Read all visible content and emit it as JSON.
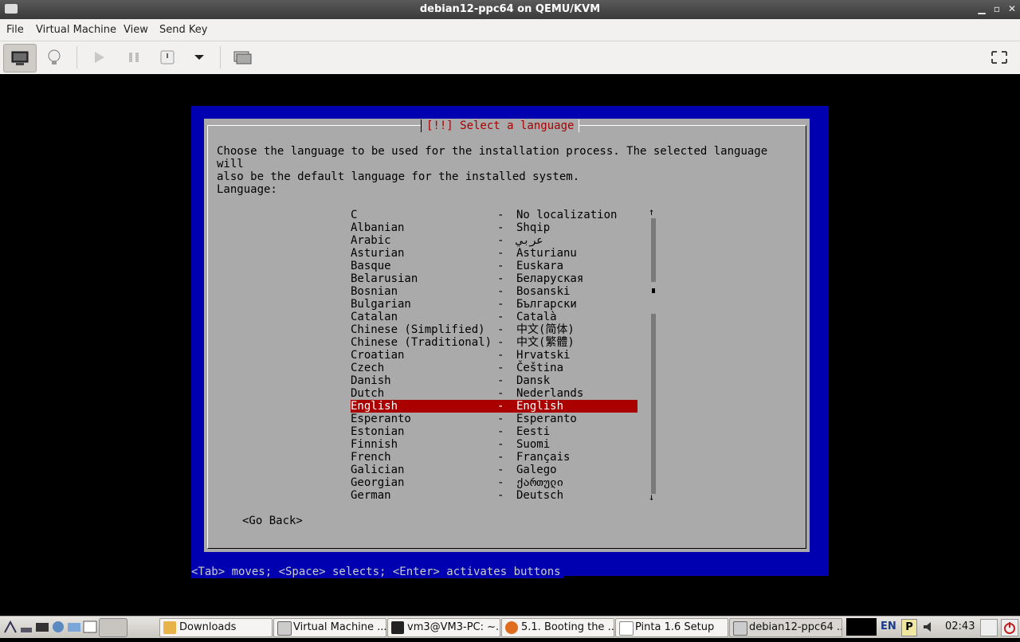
{
  "window": {
    "title": "debian12-ppc64 on QEMU/KVM"
  },
  "menu": [
    "File",
    "Virtual Machine",
    "View",
    "Send Key"
  ],
  "colors": {
    "installer_bg": "#0000b0",
    "dialog_bg": "#aaaaaa",
    "title_red": "#a80000",
    "selected_row": "#aa0000"
  },
  "installer": {
    "dialog_title": "[!!] Select a language",
    "description": "Choose the language to be used for the installation process. The selected language will\nalso be the default language for the installed system.",
    "label": "Language:",
    "languages": [
      {
        "name": "C",
        "native": "No localization"
      },
      {
        "name": "Albanian",
        "native": "Shqip"
      },
      {
        "name": "Arabic",
        "native": "عربي"
      },
      {
        "name": "Asturian",
        "native": "Asturianu"
      },
      {
        "name": "Basque",
        "native": "Euskara"
      },
      {
        "name": "Belarusian",
        "native": "Беларуская"
      },
      {
        "name": "Bosnian",
        "native": "Bosanski"
      },
      {
        "name": "Bulgarian",
        "native": "Български"
      },
      {
        "name": "Catalan",
        "native": "Català"
      },
      {
        "name": "Chinese (Simplified)",
        "native": "中文(简体)"
      },
      {
        "name": "Chinese (Traditional)",
        "native": "中文(繁體)"
      },
      {
        "name": "Croatian",
        "native": "Hrvatski"
      },
      {
        "name": "Czech",
        "native": "Čeština"
      },
      {
        "name": "Danish",
        "native": "Dansk"
      },
      {
        "name": "Dutch",
        "native": "Nederlands"
      },
      {
        "name": "English",
        "native": "English",
        "selected": true
      },
      {
        "name": "Esperanto",
        "native": "Esperanto"
      },
      {
        "name": "Estonian",
        "native": "Eesti"
      },
      {
        "name": "Finnish",
        "native": "Suomi"
      },
      {
        "name": "French",
        "native": "Français"
      },
      {
        "name": "Galician",
        "native": "Galego"
      },
      {
        "name": "Georgian",
        "native": "ქართული"
      },
      {
        "name": "German",
        "native": "Deutsch"
      }
    ],
    "separator": "-",
    "scroll_up": "↑",
    "scroll_down": "↓",
    "go_back": "<Go Back>",
    "help": "<Tab> moves; <Space> selects; <Enter> activates buttons"
  },
  "taskbar": {
    "tasks": [
      "Downloads",
      "Virtual Machine ...",
      "vm3@VM3-PC: ~...",
      "5.1. Booting the ...",
      "Pinta 1.6 Setup",
      "debian12-ppc64 ..."
    ],
    "keyboard": "EN",
    "clock": "02:43"
  }
}
